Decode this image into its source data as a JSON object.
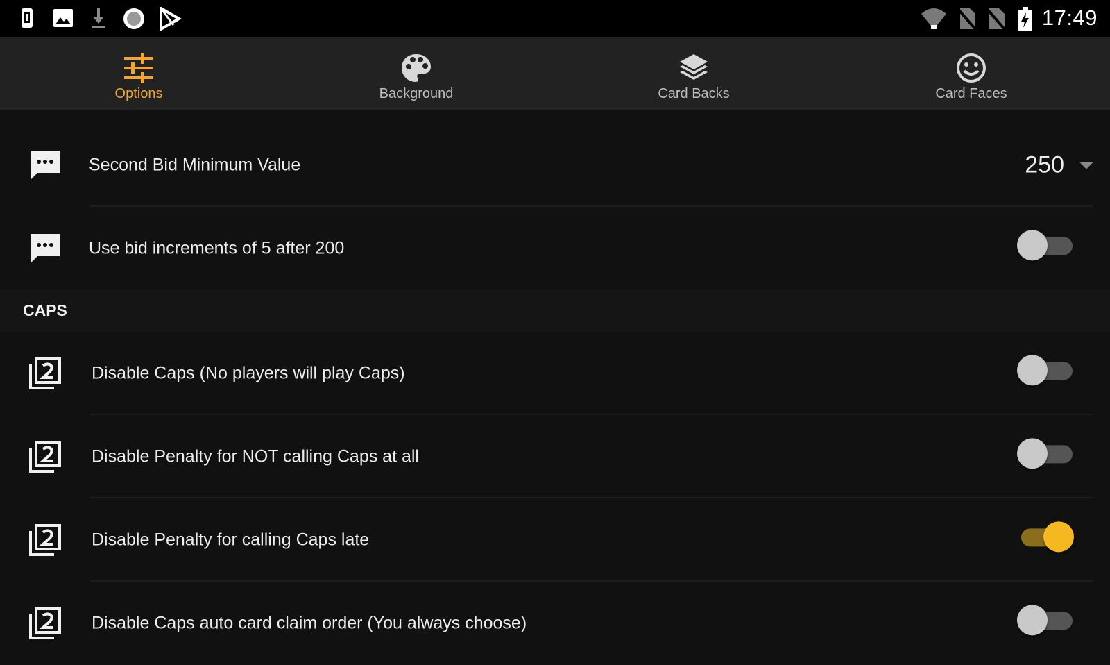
{
  "status_bar": {
    "time": "17:49",
    "left_icons": [
      "sim-icon",
      "image-icon",
      "download-icon",
      "circle-icon",
      "play-store-icon"
    ],
    "right_icons": [
      "wifi-icon",
      "no-sim-icon",
      "no-sim-icon",
      "battery-icon"
    ]
  },
  "tabs": [
    {
      "label": "Options",
      "icon": "sliders-icon",
      "active": true
    },
    {
      "label": "Background",
      "icon": "palette-icon",
      "active": false
    },
    {
      "label": "Card Backs",
      "icon": "layers-icon",
      "active": false
    },
    {
      "label": "Card Faces",
      "icon": "smiley-icon",
      "active": false
    }
  ],
  "settings": {
    "second_bid": {
      "label": "Second Bid Minimum Value",
      "value": "250",
      "icon": "chat-icon"
    },
    "bid_increments": {
      "label": "Use bid increments of 5 after 200",
      "enabled": false,
      "icon": "chat-icon"
    }
  },
  "caps_section": {
    "header": "CAPS",
    "items": [
      {
        "label": "Disable Caps (No players will play Caps)",
        "enabled": false,
        "icon": "cards-two-icon"
      },
      {
        "label": "Disable Penalty for NOT calling Caps at all",
        "enabled": false,
        "icon": "cards-two-icon"
      },
      {
        "label": "Disable Penalty for calling Caps late",
        "enabled": true,
        "icon": "cards-two-icon"
      },
      {
        "label": "Disable Caps auto card claim order (You always choose)",
        "enabled": false,
        "icon": "cards-two-icon"
      }
    ]
  },
  "colors": {
    "accent": "#f2a62e",
    "toggle_on": "#f5b820",
    "background": "#111111",
    "tabbar": "#222222"
  }
}
